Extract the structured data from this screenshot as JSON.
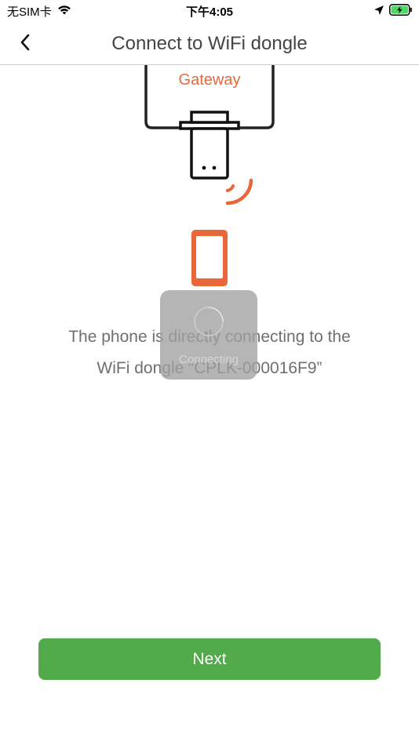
{
  "status_bar": {
    "carrier": "无SIM卡",
    "time": "下午4:05",
    "icons": [
      "wifi-icon",
      "location-arrow-icon",
      "battery-charging-icon"
    ]
  },
  "nav": {
    "title": "Connect to WiFi dongle",
    "back_icon": "chevron-left-icon"
  },
  "illustration": {
    "gateway_label": "Gateway",
    "accent_color": "#e8683a"
  },
  "message": {
    "line1": "The phone is directly connecting to the",
    "line2": "WiFi dongle “CPLK-000016F9”"
  },
  "loading": {
    "label": "Connecting"
  },
  "actions": {
    "next_label": "Next",
    "next_color": "#52aa4a"
  }
}
